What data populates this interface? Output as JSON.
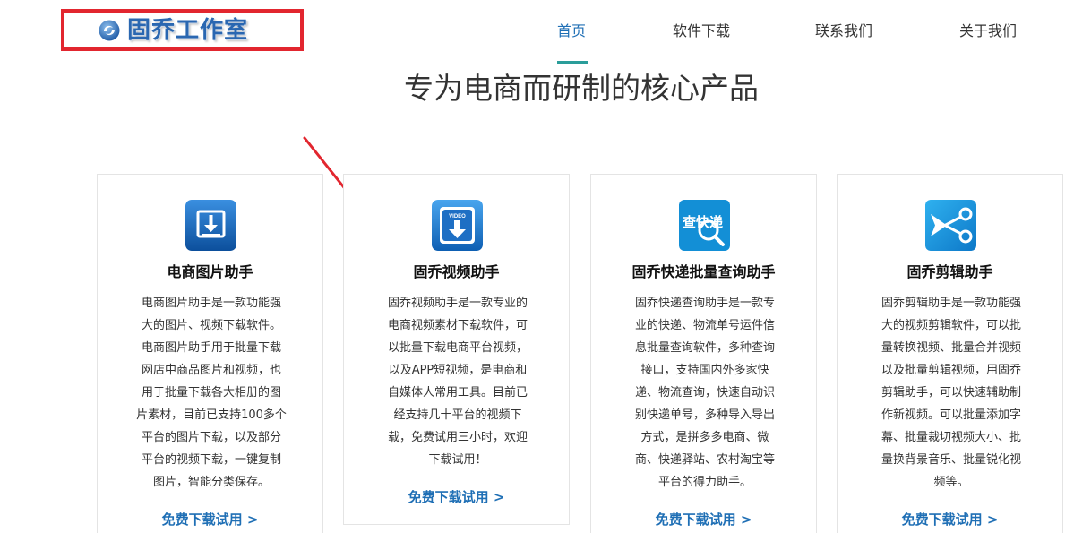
{
  "header": {
    "logo_text": "固乔工作室",
    "nav": [
      {
        "label": "首页",
        "active": true
      },
      {
        "label": "软件下载",
        "active": false
      },
      {
        "label": "联系我们",
        "active": false
      },
      {
        "label": "关于我们",
        "active": false
      }
    ]
  },
  "headline": "专为电商而研制的核心产品",
  "colors": {
    "accent_blue": "#1f6fb5",
    "nav_underline": "#2a9d9a",
    "annotation_red": "#e2262f"
  },
  "products": [
    {
      "icon": "download-box-icon",
      "title": "电商图片助手",
      "description_lines": [
        "电商图片助手是一款功能强",
        "大的图片、视频下载软件。",
        "电商图片助手用于批量下载",
        "网店中商品图片和视频，也",
        "用于批量下载各大相册的图",
        "片素材，目前已支持100多个",
        "平台的图片下载，以及部分",
        "平台的视频下载，一键复制",
        "图片，智能分类保存。"
      ],
      "cta": "免费下载试用 >"
    },
    {
      "icon": "video-download-icon",
      "icon_label": "VIDEO",
      "title": "固乔视频助手",
      "description_lines": [
        "固乔视频助手是一款专业的",
        "电商视频素材下载软件，可",
        "以批量下载电商平台视频，",
        "以及APP短视频，是电商和",
        "自媒体人常用工具。目前已",
        "经支持几十平台的视频下",
        "载，免费试用三小时，欢迎",
        "下载试用！"
      ],
      "cta": "免费下载试用 >"
    },
    {
      "icon": "express-search-icon",
      "icon_label": "查快递",
      "title": "固乔快递批量查询助手",
      "description_lines": [
        "固乔快递查询助手是一款专",
        "业的快递、物流单号运件信",
        "息批量查询软件，多种查询",
        "接口，支持国内外多家快",
        "递、物流查询，快速自动识",
        "别快递单号，多种导入导出",
        "方式，是拼多多电商、微",
        "商、快递驿站、农村淘宝等",
        "平台的得力助手。"
      ],
      "cta": "免费下载试用 >"
    },
    {
      "icon": "scissors-icon",
      "title": "固乔剪辑助手",
      "description_lines": [
        "固乔剪辑助手是一款功能强",
        "大的视频剪辑软件，可以批",
        "量转换视频、批量合并视频",
        "以及批量剪辑视频，用固乔",
        "剪辑助手，可以快速辅助制",
        "作新视频。可以批量添加字",
        "幕、批量裁切视频大小、批",
        "量换背景音乐、批量锐化视",
        "频等。"
      ],
      "cta": "免费下载试用 >"
    }
  ]
}
